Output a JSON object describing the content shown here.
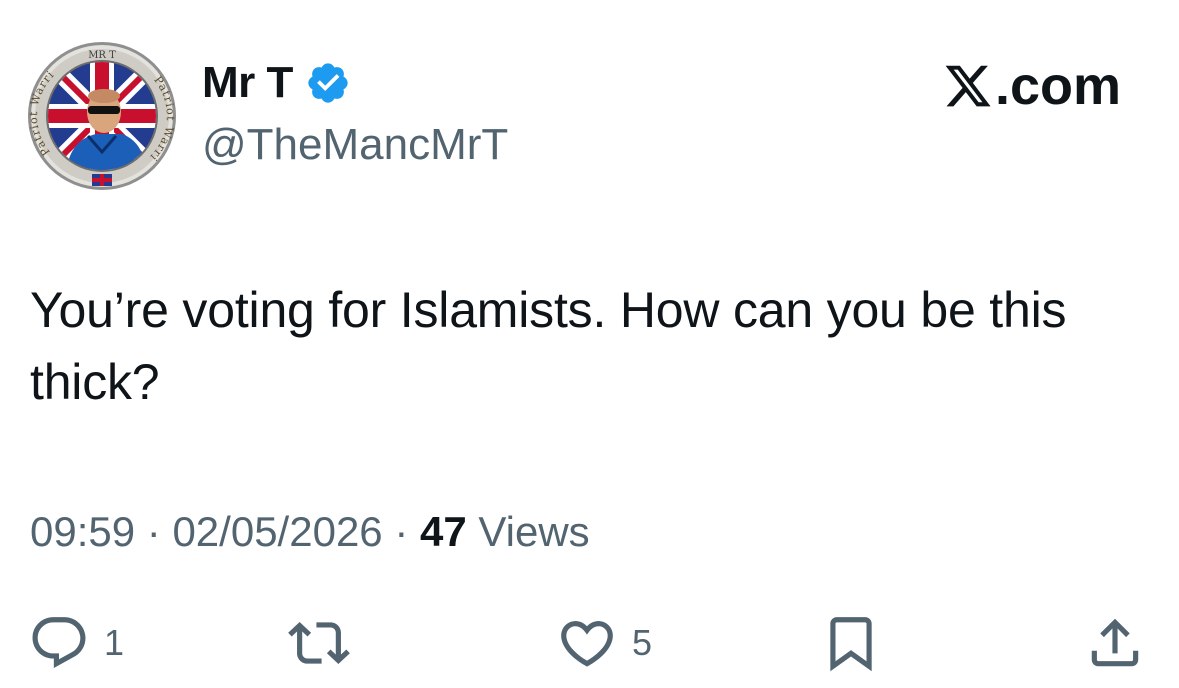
{
  "author": {
    "display_name": "Mr T",
    "handle": "@TheMancMrT",
    "verified": true,
    "avatar_badge": {
      "top_text": "MR T",
      "left_text": "Patriot Warriors",
      "right_text": "Patriot Warriors"
    }
  },
  "source": {
    "label": ".com",
    "icon": "x-logo-icon"
  },
  "tweet": {
    "text": "You’re voting for Islamists. How can you be this thick?",
    "time": "09:59",
    "separator": "·",
    "date": "02/05/2026",
    "views_count": "47",
    "views_label": "Views"
  },
  "actions": {
    "reply": {
      "icon": "reply-icon",
      "count": "1"
    },
    "repost": {
      "icon": "repost-icon",
      "count": ""
    },
    "like": {
      "icon": "heart-icon",
      "count": "5"
    },
    "bookmark": {
      "icon": "bookmark-icon",
      "count": ""
    },
    "share": {
      "icon": "share-icon",
      "count": ""
    }
  },
  "colors": {
    "text": "#0f1419",
    "secondary": "#536471",
    "verified": "#1d9bf0",
    "background": "#ffffff"
  }
}
